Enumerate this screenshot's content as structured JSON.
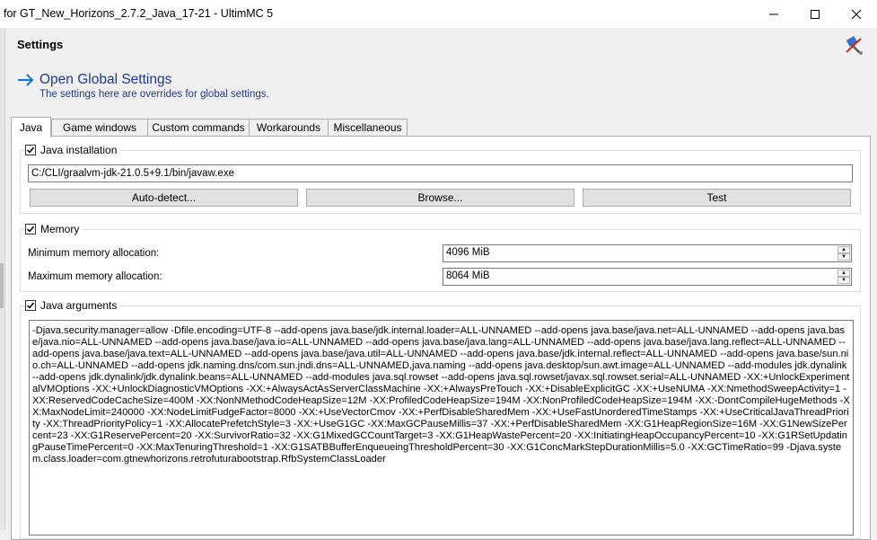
{
  "window": {
    "title": "for GT_New_Horizons_2.7.2_Java_17-21 - UltimMC 5"
  },
  "page": {
    "title": "Settings"
  },
  "header": {
    "title": "Open Global Settings",
    "subtitle": "The settings here are overrides for global settings."
  },
  "tabs": [
    {
      "label": "Java",
      "active": true
    },
    {
      "label": "Game windows",
      "active": false
    },
    {
      "label": "Custom commands",
      "active": false
    },
    {
      "label": "Workarounds",
      "active": false
    },
    {
      "label": "Miscellaneous",
      "active": false
    }
  ],
  "java_installation": {
    "label": "Java installation",
    "checked": true,
    "path": "C:/CLI/graalvm-jdk-21.0.5+9.1/bin/javaw.exe",
    "autodetect_label": "Auto-detect...",
    "browse_label": "Browse...",
    "test_label": "Test"
  },
  "memory": {
    "label": "Memory",
    "checked": true,
    "min_label": "Minimum memory allocation:",
    "min_value": "4096 MiB",
    "max_label": "Maximum memory allocation:",
    "max_value": "8064 MiB"
  },
  "java_arguments": {
    "label": "Java arguments",
    "checked": true,
    "value": "-Djava.security.manager=allow -Dfile.encoding=UTF-8 --add-opens java.base/jdk.internal.loader=ALL-UNNAMED --add-opens java.base/java.net=ALL-UNNAMED --add-opens java.base/java.nio=ALL-UNNAMED --add-opens java.base/java.io=ALL-UNNAMED --add-opens java.base/java.lang=ALL-UNNAMED --add-opens java.base/java.lang.reflect=ALL-UNNAMED --add-opens java.base/java.text=ALL-UNNAMED --add-opens java.base/java.util=ALL-UNNAMED --add-opens java.base/jdk.internal.reflect=ALL-UNNAMED --add-opens java.base/sun.nio.ch=ALL-UNNAMED --add-opens jdk.naming.dns/com.sun.jndi.dns=ALL-UNNAMED,java.naming --add-opens java.desktop/sun.awt.image=ALL-UNNAMED --add-modules jdk.dynalink --add-opens jdk.dynalink/jdk.dynalink.beans=ALL-UNNAMED --add-modules java.sql.rowset --add-opens java.sql.rowset/javax.sql.rowset.serial=ALL-UNNAMED -XX:+UnlockExperimentalVMOptions -XX:+UnlockDiagnosticVMOptions -XX:+AlwaysActAsServerClassMachine -XX:+AlwaysPreTouch -XX:+DisableExplicitGC -XX:+UseNUMA -XX:NmethodSweepActivity=1 -XX:ReservedCodeCacheSize=400M -XX:NonNMethodCodeHeapSize=12M -XX:ProfiledCodeHeapSize=194M -XX:NonProfiledCodeHeapSize=194M -XX:-DontCompileHugeMethods -XX:MaxNodeLimit=240000 -XX:NodeLimitFudgeFactor=8000 -XX:+UseVectorCmov -XX:+PerfDisableSharedMem -XX:+UseFastUnorderedTimeStamps -XX:+UseCriticalJavaThreadPriority -XX:ThreadPriorityPolicy=1 -XX:AllocatePrefetchStyle=3 -XX:+UseG1GC -XX:MaxGCPauseMillis=37 -XX:+PerfDisableSharedMem -XX:G1HeapRegionSize=16M -XX:G1NewSizePercent=23 -XX:G1ReservePercent=20 -XX:SurvivorRatio=32 -XX:G1MixedGCCountTarget=3 -XX:G1HeapWastePercent=20 -XX:InitiatingHeapOccupancyPercent=10 -XX:G1RSetUpdatingPauseTimePercent=0 -XX:MaxTenuringThreshold=1 -XX:G1SATBBufferEnqueueingThresholdPercent=30 -XX:G1ConcMarkStepDurationMillis=5.0 -XX:GCTimeRatio=99 -Djava.system.class.loader=com.gtnewhorizons.retrofuturabootstrap.RfbSystemClassLoader"
  },
  "icons": {
    "minimize": "minimize-icon",
    "maximize": "maximize-icon",
    "close": "close-icon",
    "settings": "settings-icon",
    "arrow": "arrow-right-icon",
    "checkmark": "checkmark-icon"
  },
  "colors": {
    "header_text": "#1f3a8a",
    "arrow": "#1a73c8"
  }
}
